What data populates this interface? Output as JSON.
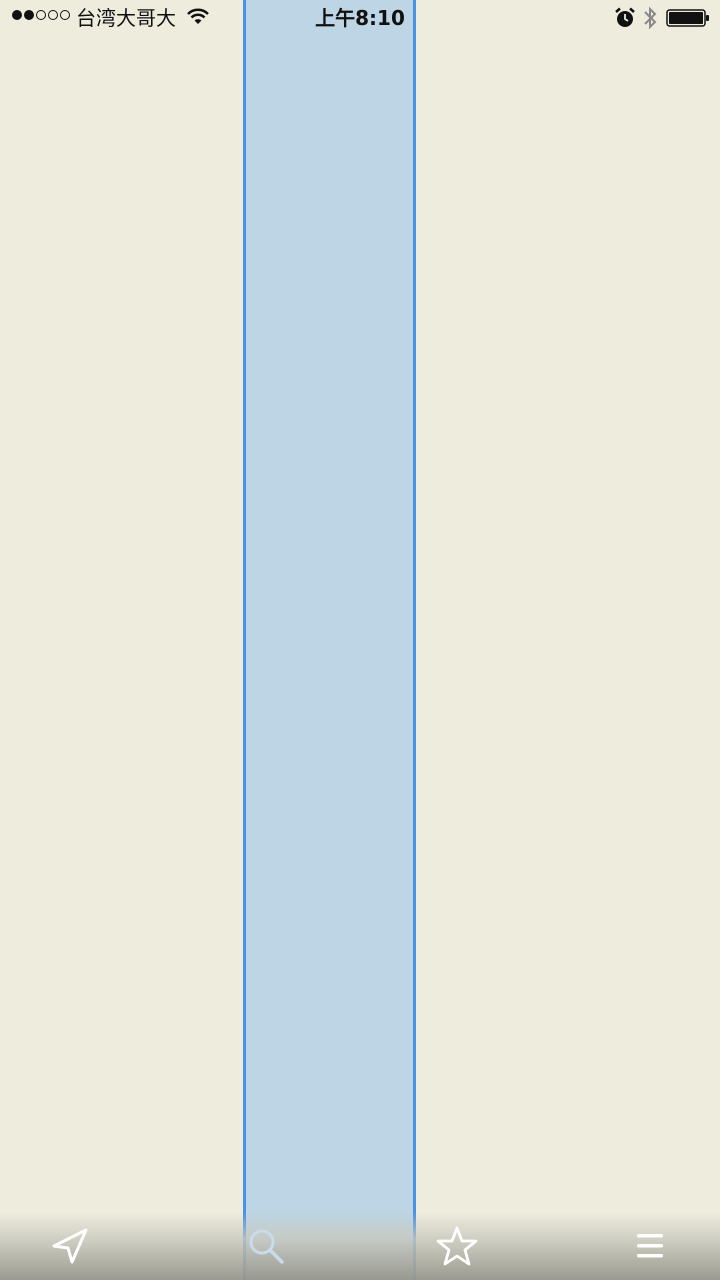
{
  "status_bar": {
    "carrier": "台湾大哥大",
    "time": "上午8:10",
    "signal_strength": 2,
    "signal_max": 5
  },
  "map": {
    "background_color": "#edecdd",
    "selection_fill": "#b0cfe6",
    "selection_border": "#4a93e3"
  },
  "toolbar": {
    "location_icon": "location-arrow-icon",
    "search_icon": "search-icon",
    "favorites_icon": "star-icon",
    "menu_icon": "hamburger-menu-icon"
  }
}
